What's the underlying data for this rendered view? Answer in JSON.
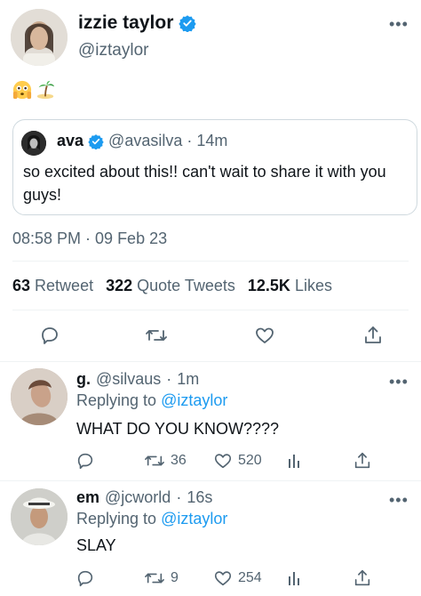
{
  "main_tweet": {
    "author_name": "izzie taylor",
    "author_handle": "@iztaylor",
    "more_label": "•••",
    "emojis": [
      "flushed-face-hands",
      "island"
    ],
    "quote": {
      "author_name": "ava",
      "author_handle": "@avasilva",
      "separator": "·",
      "time": "14m",
      "text": "so excited about this!! can't wait to share it with you guys!"
    },
    "timestamp": "08:58 PM · 09 Feb 23",
    "stats": {
      "retweets_count": "63",
      "retweets_label": "Retweet",
      "quotes_count": "322",
      "quotes_label": "Quote Tweets",
      "likes_count": "12.5K",
      "likes_label": "Likes"
    }
  },
  "replies": [
    {
      "author_name": "g.",
      "author_handle": "@silvaus",
      "separator": "·",
      "time": "1m",
      "replying_prefix": "Replying to",
      "replying_to": "@iztaylor",
      "text": "WHAT DO YOU KNOW????",
      "retweets": "36",
      "likes": "520",
      "more_label": "•••"
    },
    {
      "author_name": "em",
      "author_handle": "@jcworld",
      "separator": "·",
      "time": "16s",
      "replying_prefix": "Replying to",
      "replying_to": "@iztaylor",
      "text": "SLAY",
      "retweets": "9",
      "likes": "254",
      "more_label": "•••"
    }
  ],
  "colors": {
    "accent": "#1d9bf0",
    "text_primary": "#0f1419",
    "text_secondary": "#536471",
    "border": "#cfd9de"
  }
}
